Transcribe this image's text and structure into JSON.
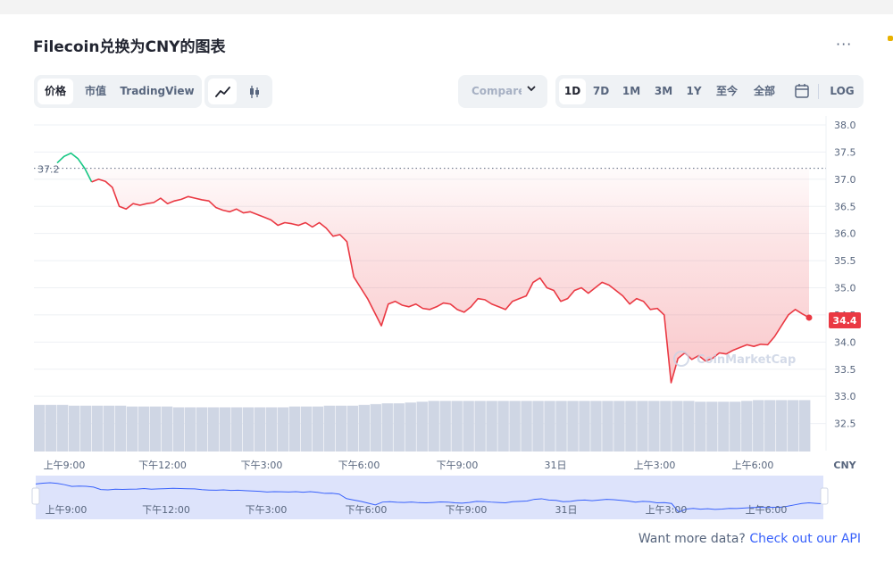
{
  "title": "Filecoin兑换为CNY的图表",
  "more_icon": "···",
  "toolbar": {
    "type_tabs": [
      "价格",
      "市值",
      "TradingView"
    ],
    "active_type": "价格",
    "chart_icons": [
      "line-chart-icon",
      "candlestick-icon"
    ],
    "compare_label": "Compare with",
    "ranges": [
      "1D",
      "7D",
      "1M",
      "3M",
      "1Y",
      "至今",
      "全部"
    ],
    "active_range": "1D",
    "calendar_icon": "calendar-icon",
    "log_label": "LOG"
  },
  "footer": {
    "text": "Want more data?",
    "link": "Check out our API"
  },
  "watermark": "CoinMarketCap",
  "colors": {
    "down": "#ea3943",
    "up": "#16c784",
    "accent": "#3861fb",
    "volume": "#cfd6e4",
    "navigator_fill": "#dde3fb"
  },
  "chart_data": {
    "type": "line",
    "title": "Filecoin兑换为CNY的图表",
    "ylabel": "",
    "y_unit": "CNY",
    "ylim": [
      32.0,
      38.0
    ],
    "y_ticks": [
      "38.0",
      "37.5",
      "37.0",
      "36.5",
      "36.0",
      "35.5",
      "35.0",
      "34.5",
      "34.0",
      "33.5",
      "33.0",
      "32.5"
    ],
    "x_ticks": [
      "上午9:00",
      "下午12:00",
      "下午3:00",
      "下午6:00",
      "下午9:00",
      "31日",
      "上午3:00",
      "上午6:00"
    ],
    "reference_price": 37.2,
    "reference_label": "37.2",
    "current_price": 34.4,
    "current_label": "34.4",
    "grid": true,
    "series": [
      {
        "values": [
          37.3,
          37.42,
          37.48,
          37.38,
          37.2,
          36.95,
          37.0,
          36.96,
          36.85,
          36.5,
          36.45,
          36.55,
          36.52,
          36.55,
          36.57,
          36.65,
          36.55,
          36.6,
          36.63,
          36.68,
          36.65,
          36.62,
          36.6,
          36.48,
          36.43,
          36.4,
          36.45,
          36.38,
          36.4,
          36.35,
          36.3,
          36.25,
          36.15,
          36.2,
          36.18,
          36.15,
          36.2,
          36.12,
          36.2,
          36.1,
          35.95,
          35.98,
          35.85,
          35.2,
          35.0,
          34.8,
          34.55,
          34.3,
          34.7,
          34.75,
          34.68,
          34.65,
          34.7,
          34.62,
          34.6,
          34.65,
          34.72,
          34.7,
          34.6,
          34.55,
          34.65,
          34.8,
          34.78,
          34.7,
          34.65,
          34.6,
          34.75,
          34.8,
          34.85,
          35.1,
          35.18,
          35.0,
          34.95,
          34.75,
          34.8,
          34.95,
          35.0,
          34.9,
          35.0,
          35.1,
          35.05,
          34.95,
          34.85,
          34.7,
          34.8,
          34.75,
          34.6,
          34.62,
          34.5,
          33.25,
          33.7,
          33.8,
          33.68,
          33.75,
          33.65,
          33.7,
          33.8,
          33.78,
          33.85,
          33.9,
          33.95,
          33.92,
          33.96,
          33.95,
          34.1,
          34.3,
          34.5,
          34.6,
          34.52,
          34.45
        ],
        "start_color": "up",
        "main_color": "down"
      }
    ],
    "volume": [
      0.58,
      0.58,
      0.58,
      0.57,
      0.57,
      0.57,
      0.57,
      0.57,
      0.56,
      0.56,
      0.56,
      0.56,
      0.55,
      0.55,
      0.55,
      0.55,
      0.55,
      0.55,
      0.55,
      0.55,
      0.55,
      0.55,
      0.56,
      0.56,
      0.56,
      0.57,
      0.57,
      0.57,
      0.58,
      0.59,
      0.6,
      0.6,
      0.61,
      0.62,
      0.63,
      0.63,
      0.63,
      0.63,
      0.63,
      0.63,
      0.63,
      0.63,
      0.63,
      0.63,
      0.63,
      0.63,
      0.63,
      0.63,
      0.63,
      0.63,
      0.63,
      0.63,
      0.63,
      0.63,
      0.63,
      0.63,
      0.63,
      0.62,
      0.62,
      0.62,
      0.62,
      0.63,
      0.64,
      0.64,
      0.64,
      0.64,
      0.64
    ],
    "navigator": {
      "x_ticks": [
        "上午9:00",
        "下午12:00",
        "下午3:00",
        "下午6:00",
        "下午9:00",
        "31日",
        "上午3:00",
        "上午6:00"
      ]
    }
  }
}
